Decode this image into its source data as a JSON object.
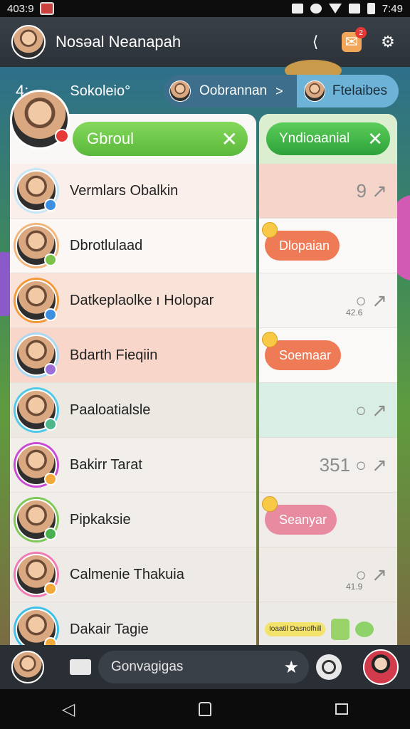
{
  "status_bar": {
    "time": "403:9",
    "clock": "7:49"
  },
  "header": {
    "title": "Nosǝal Neanapah"
  },
  "breadcrumb": {
    "number": "4:",
    "title": "Sokoleio°",
    "segment_left": "Oobrannan",
    "separator": ">",
    "segment_right": "Ftelaibes"
  },
  "list_panel": {
    "header_pill_label": "Gbroul",
    "items": [
      {
        "name": "Vermlars Obalkin",
        "badge_color": "#3b8ee0",
        "ring": "#c7e6f7"
      },
      {
        "name": "Dbrotlulaad",
        "badge_color": "#7cc24a",
        "ring": "#f2b57a"
      },
      {
        "name": "Datkeplaolke ı Holopar",
        "badge_color": "#3b8ee0",
        "ring": "#f29a3a"
      },
      {
        "name": "Bdarth Fieqiin",
        "badge_color": "#9b6fd6",
        "ring": "#a9d8f2"
      },
      {
        "name": "Paaloatialsle",
        "badge_color": "#4fb58a",
        "ring": "#4fc9e8"
      },
      {
        "name": "Bakirr Tarat",
        "badge_color": "#f0a93a",
        "ring": "#c94ad4"
      },
      {
        "name": "Pipkaksie",
        "badge_color": "#4caf50",
        "ring": "#7ec858"
      },
      {
        "name": "Calmenie Thakuia",
        "badge_color": "#f0a93a",
        "ring": "#f07ab4"
      },
      {
        "name": "Dakair Tagie",
        "badge_color": "#f0a93a",
        "ring": "#3bc0e8"
      }
    ],
    "row_colors": [
      "#fbefeb",
      "#faf7f4",
      "#f9e3d9",
      "#f8d7ca",
      "#ece8e2",
      "#f2eeea",
      "#f1ede9",
      "#eeeae6",
      "#eceae7"
    ]
  },
  "right_panel": {
    "header_pill_label": "Yndioaanial",
    "rows": [
      {
        "type": "stat",
        "text": "9 ↗",
        "bg": "#f5d4c9"
      },
      {
        "type": "pill",
        "label": "Dlopaian",
        "color": "#ef7a56",
        "bg": "#fbf9f7"
      },
      {
        "type": "stat",
        "text": "○ ↗",
        "small": "42.6",
        "bg": "#f7f5f3"
      },
      {
        "type": "pill",
        "label": "Soemaar",
        "color": "#ef7a56",
        "bg": "#fbf9f7"
      },
      {
        "type": "stat",
        "text": "○ ↗",
        "bg": "#d9eee4"
      },
      {
        "type": "stat",
        "text": "351 ○ ↗",
        "bg": "#f2efec"
      },
      {
        "type": "pill",
        "label": "Seanyar",
        "color": "#e88aa0",
        "bg": "#f0ece9"
      },
      {
        "type": "stat",
        "text": "○ ↗",
        "small": "41.9",
        "bg": "#eeeae6"
      },
      {
        "type": "tiles",
        "label": "Ioaatil Dasnofhill",
        "bg": "#eceae7"
      }
    ]
  },
  "input_bar": {
    "placeholder": "Gonvagigas"
  },
  "nav": {
    "back": "◁"
  }
}
